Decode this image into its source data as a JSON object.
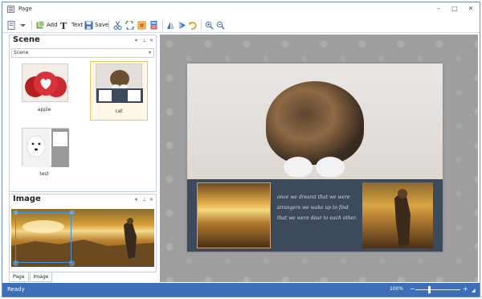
{
  "window": {
    "title": "Page",
    "controls": {
      "minimize": "–",
      "maximize": "□",
      "close": "✕"
    }
  },
  "toolbar": {
    "add_label": "Add",
    "text_label": "Text",
    "save_label": "Save",
    "icons": [
      "page-icon",
      "dropdown-icon",
      "add-icon",
      "text-icon",
      "save-icon",
      "cut-icon",
      "refresh-icon",
      "export-icon",
      "layers-icon",
      "flip-icon",
      "play-icon",
      "rotate-icon",
      "zoom-in-icon",
      "zoom-out-icon"
    ]
  },
  "scene_panel": {
    "title": "Scene",
    "selector_value": "Scene",
    "controls": {
      "menu": "▾",
      "pin": "⊥",
      "close": "✕"
    },
    "items": [
      {
        "label": "apple"
      },
      {
        "label": "cat"
      },
      {
        "label": "test"
      }
    ]
  },
  "image_panel": {
    "title": "Image",
    "controls": {
      "menu": "▾",
      "pin": "⊥",
      "close": "✕"
    }
  },
  "bottom_tabs": [
    "Page",
    "Image"
  ],
  "canvas": {
    "script_text": "once we dreamt that we were strangers we wake up to find that we were dear to each other."
  },
  "statusbar": {
    "status": "Ready",
    "zoom": "100%",
    "zoom_level": 1.0
  },
  "colors": {
    "accent": "#3d6fb8",
    "selection": "#f0c26b",
    "handles": "#3e92e0",
    "canvas_bg": "#9e9e9e",
    "page_band": "#3c4a5c"
  }
}
